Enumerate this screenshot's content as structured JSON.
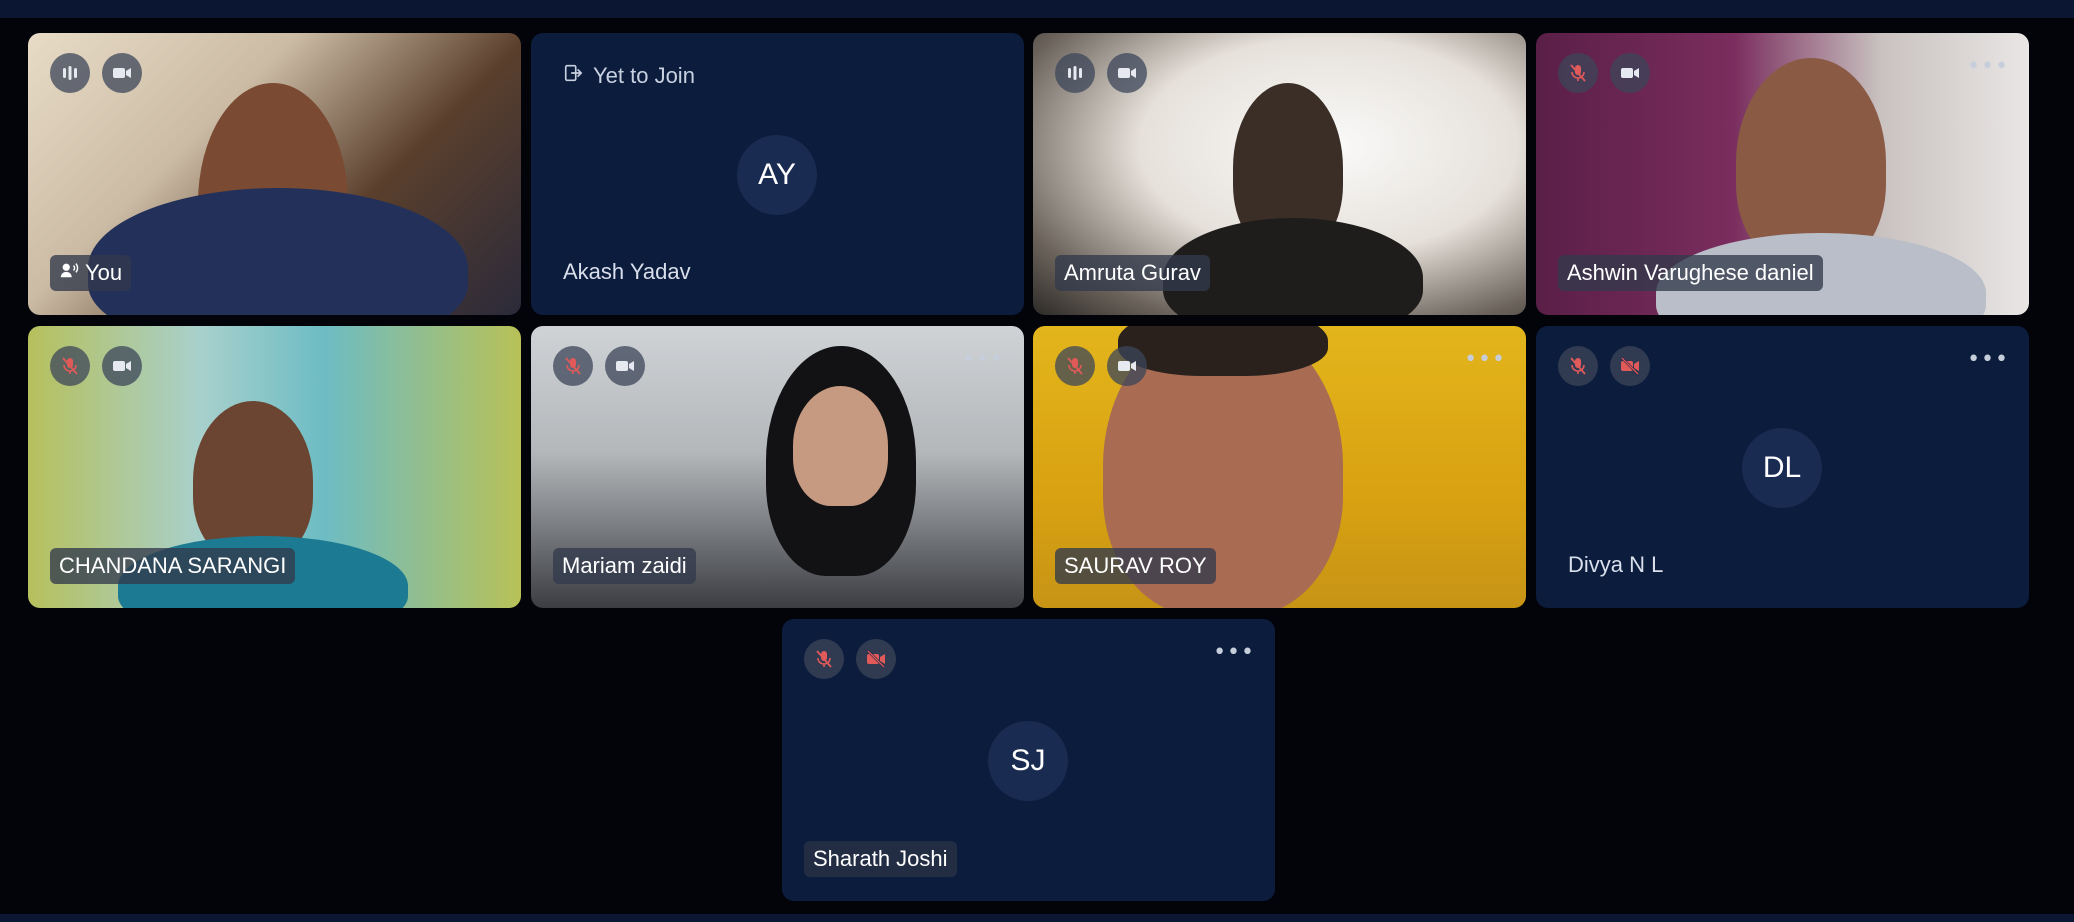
{
  "participants": [
    {
      "name": "You",
      "initials": ""
    },
    {
      "name": "Akash Yadav",
      "initials": "AY",
      "status": "Yet to Join"
    },
    {
      "name": "Amruta Gurav",
      "initials": ""
    },
    {
      "name": "Ashwin Varughese daniel",
      "initials": ""
    },
    {
      "name": "CHANDANA SARANGI",
      "initials": ""
    },
    {
      "name": "Mariam zaidi",
      "initials": ""
    },
    {
      "name": "SAURAV ROY",
      "initials": ""
    },
    {
      "name": "Divya N L",
      "initials": "DL"
    },
    {
      "name": "Sharath Joshi",
      "initials": "SJ"
    }
  ],
  "icons": {
    "more": "more-options-icon",
    "mic_muted": "mic-muted-icon",
    "audio_level": "audio-level-icon",
    "camera": "camera-icon",
    "camera_off": "camera-off-icon",
    "speaker": "speaking-icon",
    "join": "join-icon"
  },
  "colors": {
    "background": "#020409",
    "tile": "#0c1c3d",
    "avatar": "#1a2b52",
    "muted_red": "#e05a5a"
  }
}
